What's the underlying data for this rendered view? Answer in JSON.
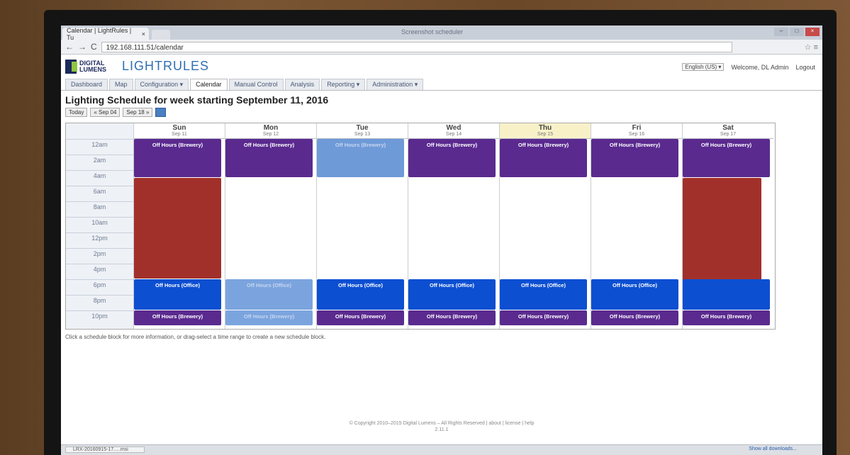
{
  "browser": {
    "tab_title": "Calendar | LightRules | Tu",
    "tab_close": "×",
    "window_title": "Screenshot scheduler",
    "url": "192.168.111.51/calendar",
    "star": "☆ ≡"
  },
  "header": {
    "logo_text": "DIGITAL LUMENS",
    "product": "LIGHTRULES",
    "language": "English (US) ▾",
    "welcome": "Welcome, DL Admin",
    "logout": "Logout"
  },
  "menu": [
    "Dashboard",
    "Map",
    "Configuration ▾",
    "Calendar",
    "Manual Control",
    "Analysis",
    "Reporting ▾",
    "Administration ▾"
  ],
  "page_title": "Lighting Schedule for week starting September 11, 2016",
  "weeknav": {
    "today": "Today",
    "prev": "« Sep 04",
    "next": "Sep 18 »"
  },
  "time_slots": [
    "12am",
    "2am",
    "4am",
    "6am",
    "8am",
    "10am",
    "12pm",
    "2pm",
    "4pm",
    "6pm",
    "8pm",
    "10pm"
  ],
  "days": [
    {
      "name": "Sun",
      "date": "Sep 11",
      "today": false
    },
    {
      "name": "Mon",
      "date": "Sep 12",
      "today": false
    },
    {
      "name": "Tue",
      "date": "Sep 13",
      "today": false
    },
    {
      "name": "Wed",
      "date": "Sep 14",
      "today": false
    },
    {
      "name": "Thu",
      "date": "Sep 15",
      "today": true
    },
    {
      "name": "Fri",
      "date": "Sep 16",
      "today": false
    },
    {
      "name": "Sat",
      "date": "Sep 17",
      "today": false
    }
  ],
  "blocks": [
    {
      "day": 0,
      "start": 0,
      "end": 5,
      "style": "purple",
      "label": "Off Hours (Brewery)"
    },
    {
      "day": 0,
      "start": 5,
      "end": 18,
      "style": "red",
      "label": ""
    },
    {
      "day": 0,
      "start": 18,
      "end": 22,
      "style": "blue",
      "label": "Off Hours (Office)"
    },
    {
      "day": 0,
      "start": 22,
      "end": 24,
      "style": "purple",
      "label": "Off Hours (Brewery)"
    },
    {
      "day": 1,
      "start": 0,
      "end": 5,
      "style": "purple",
      "label": "Off Hours (Brewery)"
    },
    {
      "day": 1,
      "start": 18,
      "end": 22,
      "style": "lightblue",
      "label": "Off Hours (Office)"
    },
    {
      "day": 1,
      "start": 22,
      "end": 24,
      "style": "lightblue",
      "label": "Off Hours (Brewery)"
    },
    {
      "day": 2,
      "start": 0,
      "end": 5,
      "style": "lavender",
      "label": "Off Hours (Brewery)"
    },
    {
      "day": 2,
      "start": 18,
      "end": 22,
      "style": "blue",
      "label": "Off Hours (Office)"
    },
    {
      "day": 2,
      "start": 22,
      "end": 24,
      "style": "purple",
      "label": "Off Hours (Brewery)"
    },
    {
      "day": 3,
      "start": 0,
      "end": 5,
      "style": "purple",
      "label": "Off Hours (Brewery)"
    },
    {
      "day": 3,
      "start": 18,
      "end": 22,
      "style": "blue",
      "label": "Off Hours (Office)"
    },
    {
      "day": 3,
      "start": 22,
      "end": 24,
      "style": "purple",
      "label": "Off Hours (Brewery)"
    },
    {
      "day": 4,
      "start": 0,
      "end": 5,
      "style": "purple",
      "label": "Off Hours (Brewery)"
    },
    {
      "day": 4,
      "start": 18,
      "end": 22,
      "style": "blue",
      "label": "Off Hours (Office)"
    },
    {
      "day": 4,
      "start": 22,
      "end": 24,
      "style": "purple",
      "label": "Off Hours (Brewery)"
    },
    {
      "day": 5,
      "start": 0,
      "end": 5,
      "style": "purple",
      "label": "Off Hours (Brewery)"
    },
    {
      "day": 5,
      "start": 18,
      "end": 22,
      "style": "blue",
      "label": "Off Hours (Office)"
    },
    {
      "day": 5,
      "start": 22,
      "end": 24,
      "style": "purple",
      "label": "Off Hours (Brewery)"
    },
    {
      "day": 6,
      "start": 0,
      "end": 5,
      "style": "purple",
      "label": "Off Hours (Brewery)"
    },
    {
      "day": 6,
      "start": 5,
      "end": 22,
      "style": "red",
      "label": ""
    },
    {
      "day": 6,
      "start": 18,
      "end": 22,
      "style": "blue",
      "label": ""
    },
    {
      "day": 6,
      "start": 22,
      "end": 24,
      "style": "purple",
      "label": "Off Hours (Brewery)"
    }
  ],
  "hint": "Click a schedule block for more information, or drag-select a time range to create a new schedule block.",
  "footer": {
    "copyright": "© Copyright 2010–2015 Digital Lumens – All Rights Reserved | about | license | help",
    "version": "2.11.1"
  },
  "downloads": {
    "item": "LRX-20160915-17.....msi",
    "show_all": "Show all downloads..."
  },
  "colors": {
    "purple": "#5a2a8f",
    "blue": "#0c4fd1",
    "red": "#a2302a",
    "today_header": "#f8f1c8",
    "brand_blue": "#2e6fb0",
    "brand_green": "#8dc63f"
  }
}
